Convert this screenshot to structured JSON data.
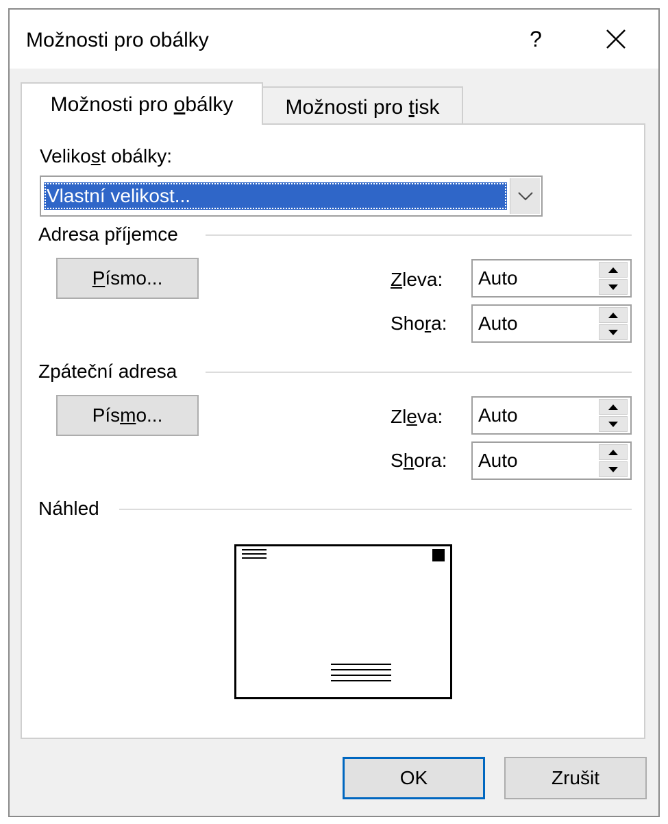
{
  "dialog": {
    "title": "Možnosti pro obálky",
    "help_label": "?",
    "close_icon": "close-icon"
  },
  "tabs": [
    {
      "label_pre": "Možnosti pro ",
      "label_u": "o",
      "label_post": "bálky",
      "active": true
    },
    {
      "label_pre": "Možnosti pro ",
      "label_u": "t",
      "label_post": "isk",
      "active": false
    }
  ],
  "envelope_size": {
    "label_pre": "Veliko",
    "label_u": "s",
    "label_post": "t obálky:",
    "selected_value": "Vlastní velikost..."
  },
  "recipient": {
    "group_label": "Adresa příjemce",
    "font_button": {
      "pre": "",
      "u": "P",
      "post": "ísmo..."
    },
    "left_label": {
      "pre": "",
      "u": "Z",
      "post": "leva:"
    },
    "left_value": "Auto",
    "top_label": {
      "pre": "Sho",
      "u": "r",
      "post": "a:"
    },
    "top_value": "Auto"
  },
  "return_address": {
    "group_label": "Zpáteční adresa",
    "font_button": {
      "pre": "Pís",
      "u": "m",
      "post": "o..."
    },
    "left_label": {
      "pre": "Zl",
      "u": "e",
      "post": "va:"
    },
    "left_value": "Auto",
    "top_label": {
      "pre": "S",
      "u": "h",
      "post": "ora:"
    },
    "top_value": "Auto"
  },
  "preview": {
    "group_label": "Náhled"
  },
  "buttons": {
    "ok_label": "OK",
    "cancel_label": "Zrušit"
  }
}
